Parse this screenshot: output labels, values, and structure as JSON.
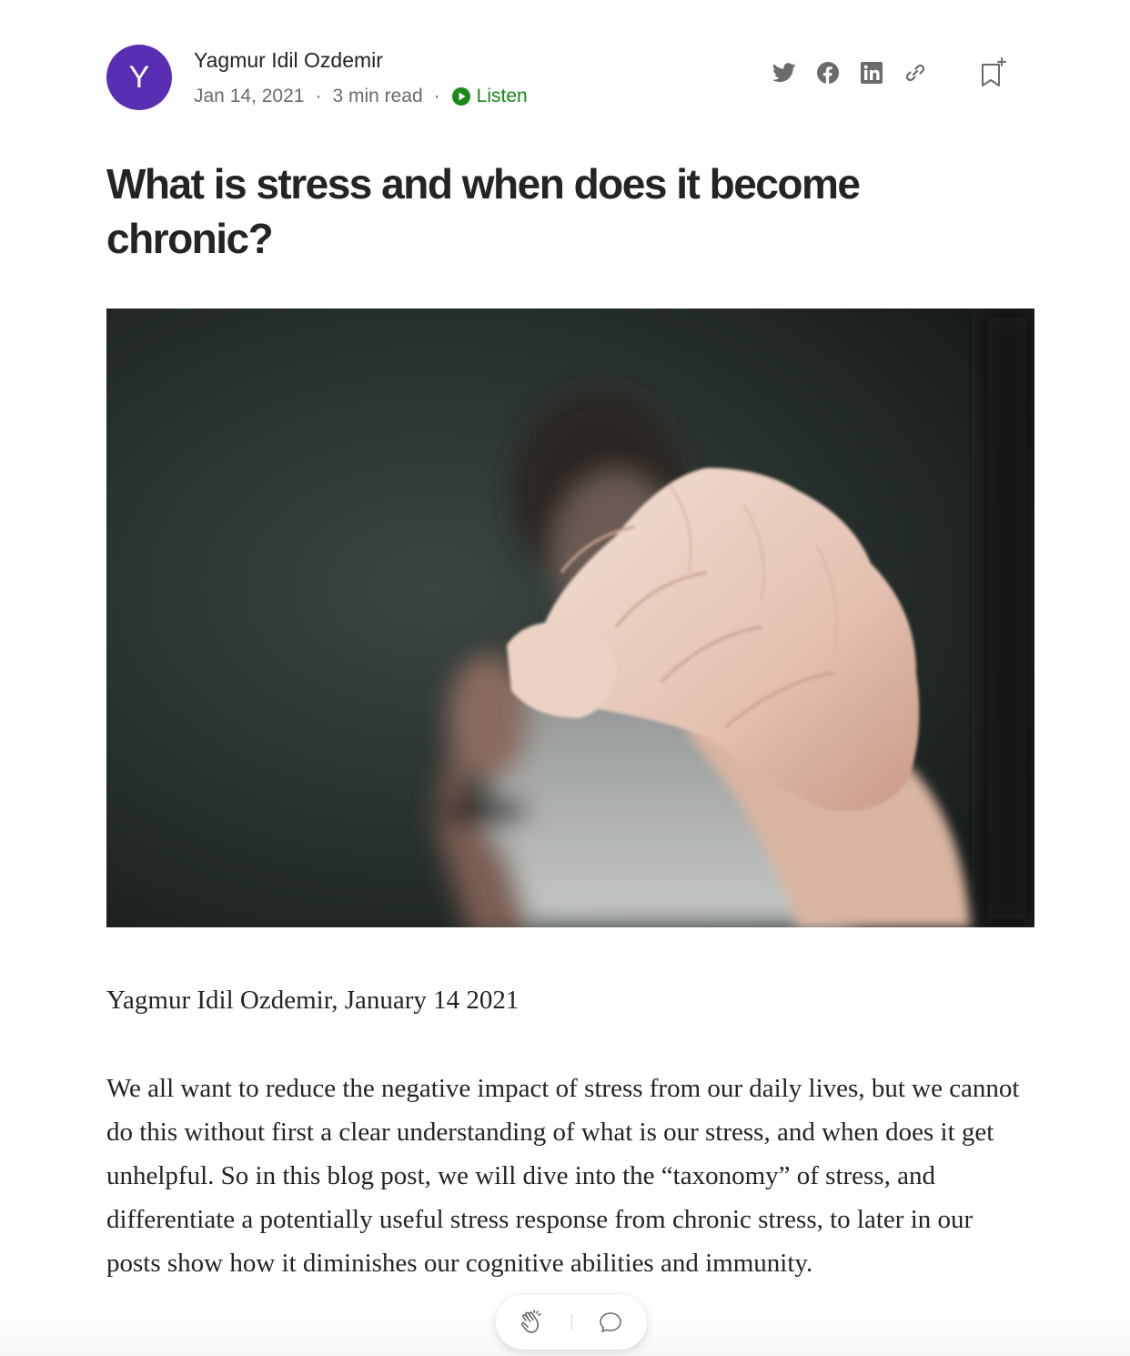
{
  "author": {
    "initial": "Y",
    "name": "Yagmur Idil Ozdemir",
    "avatar_color": "#5a2eb2"
  },
  "meta": {
    "date": "Jan 14, 2021",
    "separator": "·",
    "read_time": "3 min read",
    "listen_label": "Listen"
  },
  "share": {
    "icons": [
      "twitter-icon",
      "facebook-icon",
      "linkedin-icon",
      "link-icon"
    ],
    "bookmark_icon": "bookmark-add-icon"
  },
  "article": {
    "title": "What is stress and when does it become chronic?",
    "byline": "Yagmur Idil Ozdemir, January 14 2021",
    "paragraph": "We all want to reduce the negative impact of stress from our daily lives, but we cannot do this without first a clear understanding of what is our stress, and when does it get unhelpful. So in this blog post, we will dive into the “taxonomy” of stress, and differentiate a potentially useful stress response from chronic stress, to later in our posts show how it diminishes our cognitive abilities and immunity."
  },
  "floating_actions": {
    "clap_icon": "clap-icon",
    "comment_icon": "comment-icon"
  },
  "colors": {
    "accent_green": "#1a8917",
    "text_primary": "#242424",
    "text_secondary": "#6b6b6b"
  }
}
